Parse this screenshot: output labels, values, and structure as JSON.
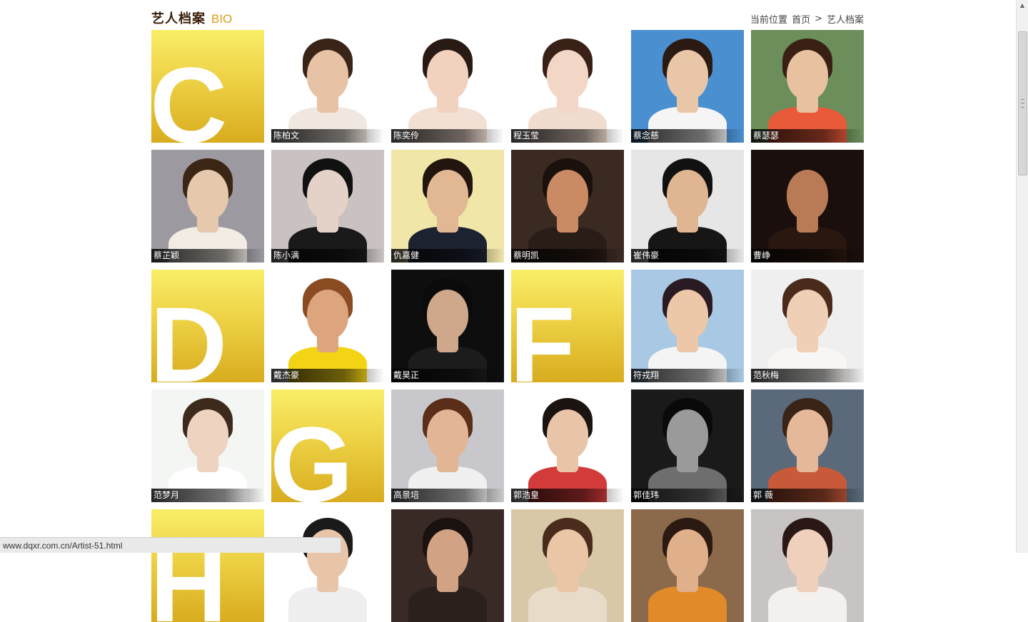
{
  "header": {
    "title_zh": "艺人档案",
    "title_en": "BIO",
    "breadcrumb": {
      "prefix": "当前位置",
      "home": "首页",
      "separator": ">",
      "current": "艺人档案"
    }
  },
  "tiles": [
    {
      "type": "letter",
      "letter": "C"
    },
    {
      "type": "artist",
      "name": "陈柏文",
      "bg": "#ffffff",
      "skin": "#e8c2a4",
      "hair": "#3a2418",
      "cloth": "#f0e8e0"
    },
    {
      "type": "artist",
      "name": "陈奕伶",
      "bg": "#ffffff",
      "skin": "#f1d2be",
      "hair": "#2a1a14",
      "cloth": "#f3e0d4"
    },
    {
      "type": "artist",
      "name": "程玉莹",
      "bg": "#ffffff",
      "skin": "#f2d6c6",
      "hair": "#3a2118",
      "cloth": "#f1ddd0"
    },
    {
      "type": "artist",
      "name": "蔡念慈",
      "bg": "#4a8fd0",
      "skin": "#e9c6a8",
      "hair": "#2b1a12",
      "cloth": "#f5f5f5"
    },
    {
      "type": "artist",
      "name": "蔡瑟瑟",
      "bg": "#6b8e5a",
      "skin": "#e8c1a0",
      "hair": "#3a2014",
      "cloth": "#e85a3a"
    },
    {
      "type": "artist",
      "name": "蔡芷颖",
      "bg": "#9c9aa0",
      "skin": "#e6c8ad",
      "hair": "#3b2616",
      "cloth": "#f2ece4"
    },
    {
      "type": "artist",
      "name": "陈小满",
      "bg": "#c9c2c0",
      "skin": "#e4d2c9",
      "hair": "#111111",
      "cloth": "#1a1a1a"
    },
    {
      "type": "artist",
      "name": "仇嘉健",
      "bg": "#f0e6a8",
      "skin": "#e2b894",
      "hair": "#22150e",
      "cloth": "#1d2230"
    },
    {
      "type": "artist",
      "name": "蔡明凯",
      "bg": "#3a2a22",
      "skin": "#c98a64",
      "hair": "#1b110c",
      "cloth": "#2a1d17"
    },
    {
      "type": "artist",
      "name": "崔伟豪",
      "bg": "#e6e6e6",
      "skin": "#e0b592",
      "hair": "#111111",
      "cloth": "#161616"
    },
    {
      "type": "artist",
      "name": "曹峥",
      "bg": "#1a0f0c",
      "skin": "#b97b56",
      "hair": "#1a0f0c",
      "cloth": "#2a1810"
    },
    {
      "type": "letter",
      "letter": "D"
    },
    {
      "type": "artist",
      "name": "戴杰豪",
      "bg": "#ffffff",
      "skin": "#dca57e",
      "hair": "#8a4a22",
      "cloth": "#f3d414"
    },
    {
      "type": "artist",
      "name": "戴昊正",
      "bg": "#0e0e0e",
      "skin": "#cfa78a",
      "hair": "#0b0b0b",
      "cloth": "#1c1c1c"
    },
    {
      "type": "letter",
      "letter": "F"
    },
    {
      "type": "artist",
      "name": "符戎翔",
      "bg": "#a8c8e4",
      "skin": "#ecc7a8",
      "hair": "#2a1a22",
      "cloth": "#f4f4f4"
    },
    {
      "type": "artist",
      "name": "范秋梅",
      "bg": "#f0efef",
      "skin": "#efcfb6",
      "hair": "#4a2a1a",
      "cloth": "#f8f6f4"
    },
    {
      "type": "artist",
      "name": "范梦月",
      "bg": "#f4f6f4",
      "skin": "#eed3c0",
      "hair": "#3e2a1c",
      "cloth": "#ffffff"
    },
    {
      "type": "letter",
      "letter": "G"
    },
    {
      "type": "artist",
      "name": "高景培",
      "bg": "#c8c8cc",
      "skin": "#e2b594",
      "hair": "#5a2e18",
      "cloth": "#f0f0f0"
    },
    {
      "type": "artist",
      "name": "郭浩皇",
      "bg": "#ffffff",
      "skin": "#e8c4a8",
      "hair": "#1b1310",
      "cloth": "#d33a3a"
    },
    {
      "type": "artist",
      "name": "郭佳玮",
      "bg": "#1a1a1a",
      "skin": "#9a9a9a",
      "hair": "#0a0a0a",
      "cloth": "#6e6e6e"
    },
    {
      "type": "artist",
      "name": "郭 薇",
      "bg": "#5a6a7a",
      "skin": "#e4b898",
      "hair": "#3a2418",
      "cloth": "#c85a3a"
    },
    {
      "type": "letter",
      "letter": "H"
    },
    {
      "type": "artist",
      "name": "",
      "bg": "#ffffff",
      "skin": "#e8c4a8",
      "hair": "#1a1a1a",
      "cloth": "#eeeeee"
    },
    {
      "type": "artist",
      "name": "",
      "bg": "#3a2a26",
      "skin": "#d2a284",
      "hair": "#1a1210",
      "cloth": "#2a201c"
    },
    {
      "type": "artist",
      "name": "",
      "bg": "#d8c8a8",
      "skin": "#eac6a6",
      "hair": "#4a2c1c",
      "cloth": "#e8dcc8"
    },
    {
      "type": "artist",
      "name": "",
      "bg": "#8a6a4a",
      "skin": "#e0b08a",
      "hair": "#2a1a12",
      "cloth": "#e08a2a"
    },
    {
      "type": "artist",
      "name": "",
      "bg": "#c8c4c4",
      "skin": "#eed0bc",
      "hair": "#2a1816",
      "cloth": "#f4f0ee"
    }
  ],
  "status_url": "www.dqxr.com.cn/Artist-51.html"
}
